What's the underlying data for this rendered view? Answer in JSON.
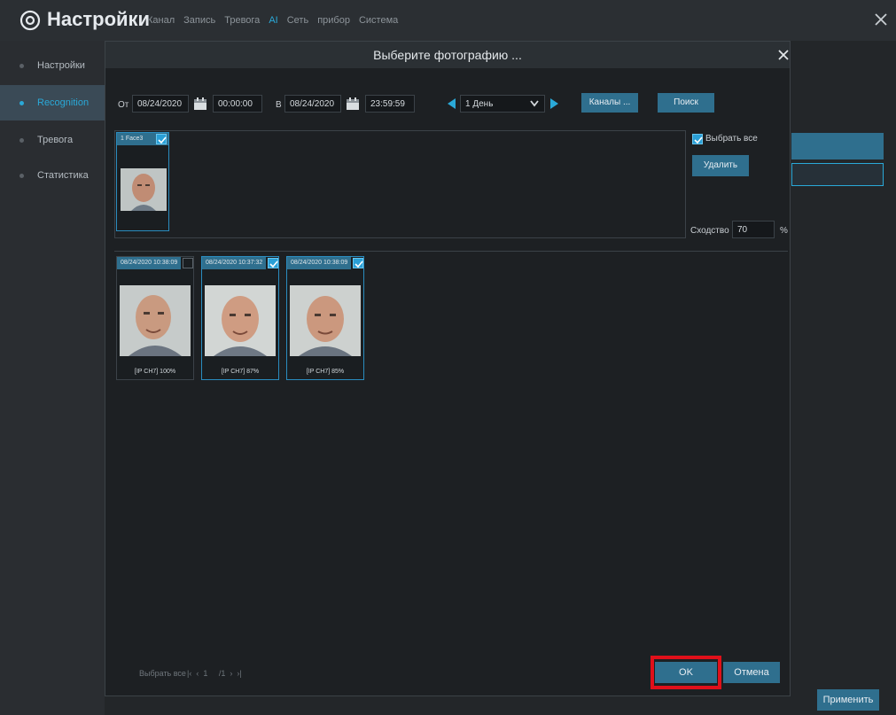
{
  "app": {
    "title": "Настройки",
    "menu": [
      "Канал",
      "Запись",
      "Тревога",
      "AI",
      "Сеть",
      "прибор",
      "Система"
    ],
    "active_menu": "AI"
  },
  "sidebar": {
    "items": [
      {
        "label": "Настройки"
      },
      {
        "label": "Recognition"
      },
      {
        "label": "Тревога"
      },
      {
        "label": "Статистика"
      }
    ]
  },
  "apply_label": "Применить",
  "dialog": {
    "title": "Выберите фотографию ...",
    "from_label": "От",
    "from_date": "08/24/2020",
    "from_time": "00:00:00",
    "to_label": "В",
    "to_date": "08/24/2020",
    "to_time": "23:59:59",
    "period": "1 День",
    "channels_label": "Каналы ...",
    "search_label": "Поиск",
    "select_all_label": "Выбрать все",
    "delete_label": "Удалить",
    "similarity_label": "Сходство",
    "similarity_value": "70",
    "percent": "%",
    "selected_face": {
      "label": "1  Face3",
      "checked": true
    },
    "results": [
      {
        "time": "08/24/2020 10:38:09",
        "caption": "[IP CH7] 100%",
        "checked": false
      },
      {
        "time": "08/24/2020 10:37:32",
        "caption": "[IP CH7] 87%",
        "checked": true
      },
      {
        "time": "08/24/2020 10:38:09",
        "caption": "[IP CH7] 85%",
        "checked": true
      }
    ],
    "footer_select_all": "Выбрать все",
    "pager": "|‹  ‹  1     /1  ›  ›|",
    "ok_label": "OK",
    "cancel_label": "Отмена"
  },
  "colors": {
    "accent": "#2aa9d8",
    "button": "#2f6f8e",
    "highlight": "#e0101a"
  }
}
